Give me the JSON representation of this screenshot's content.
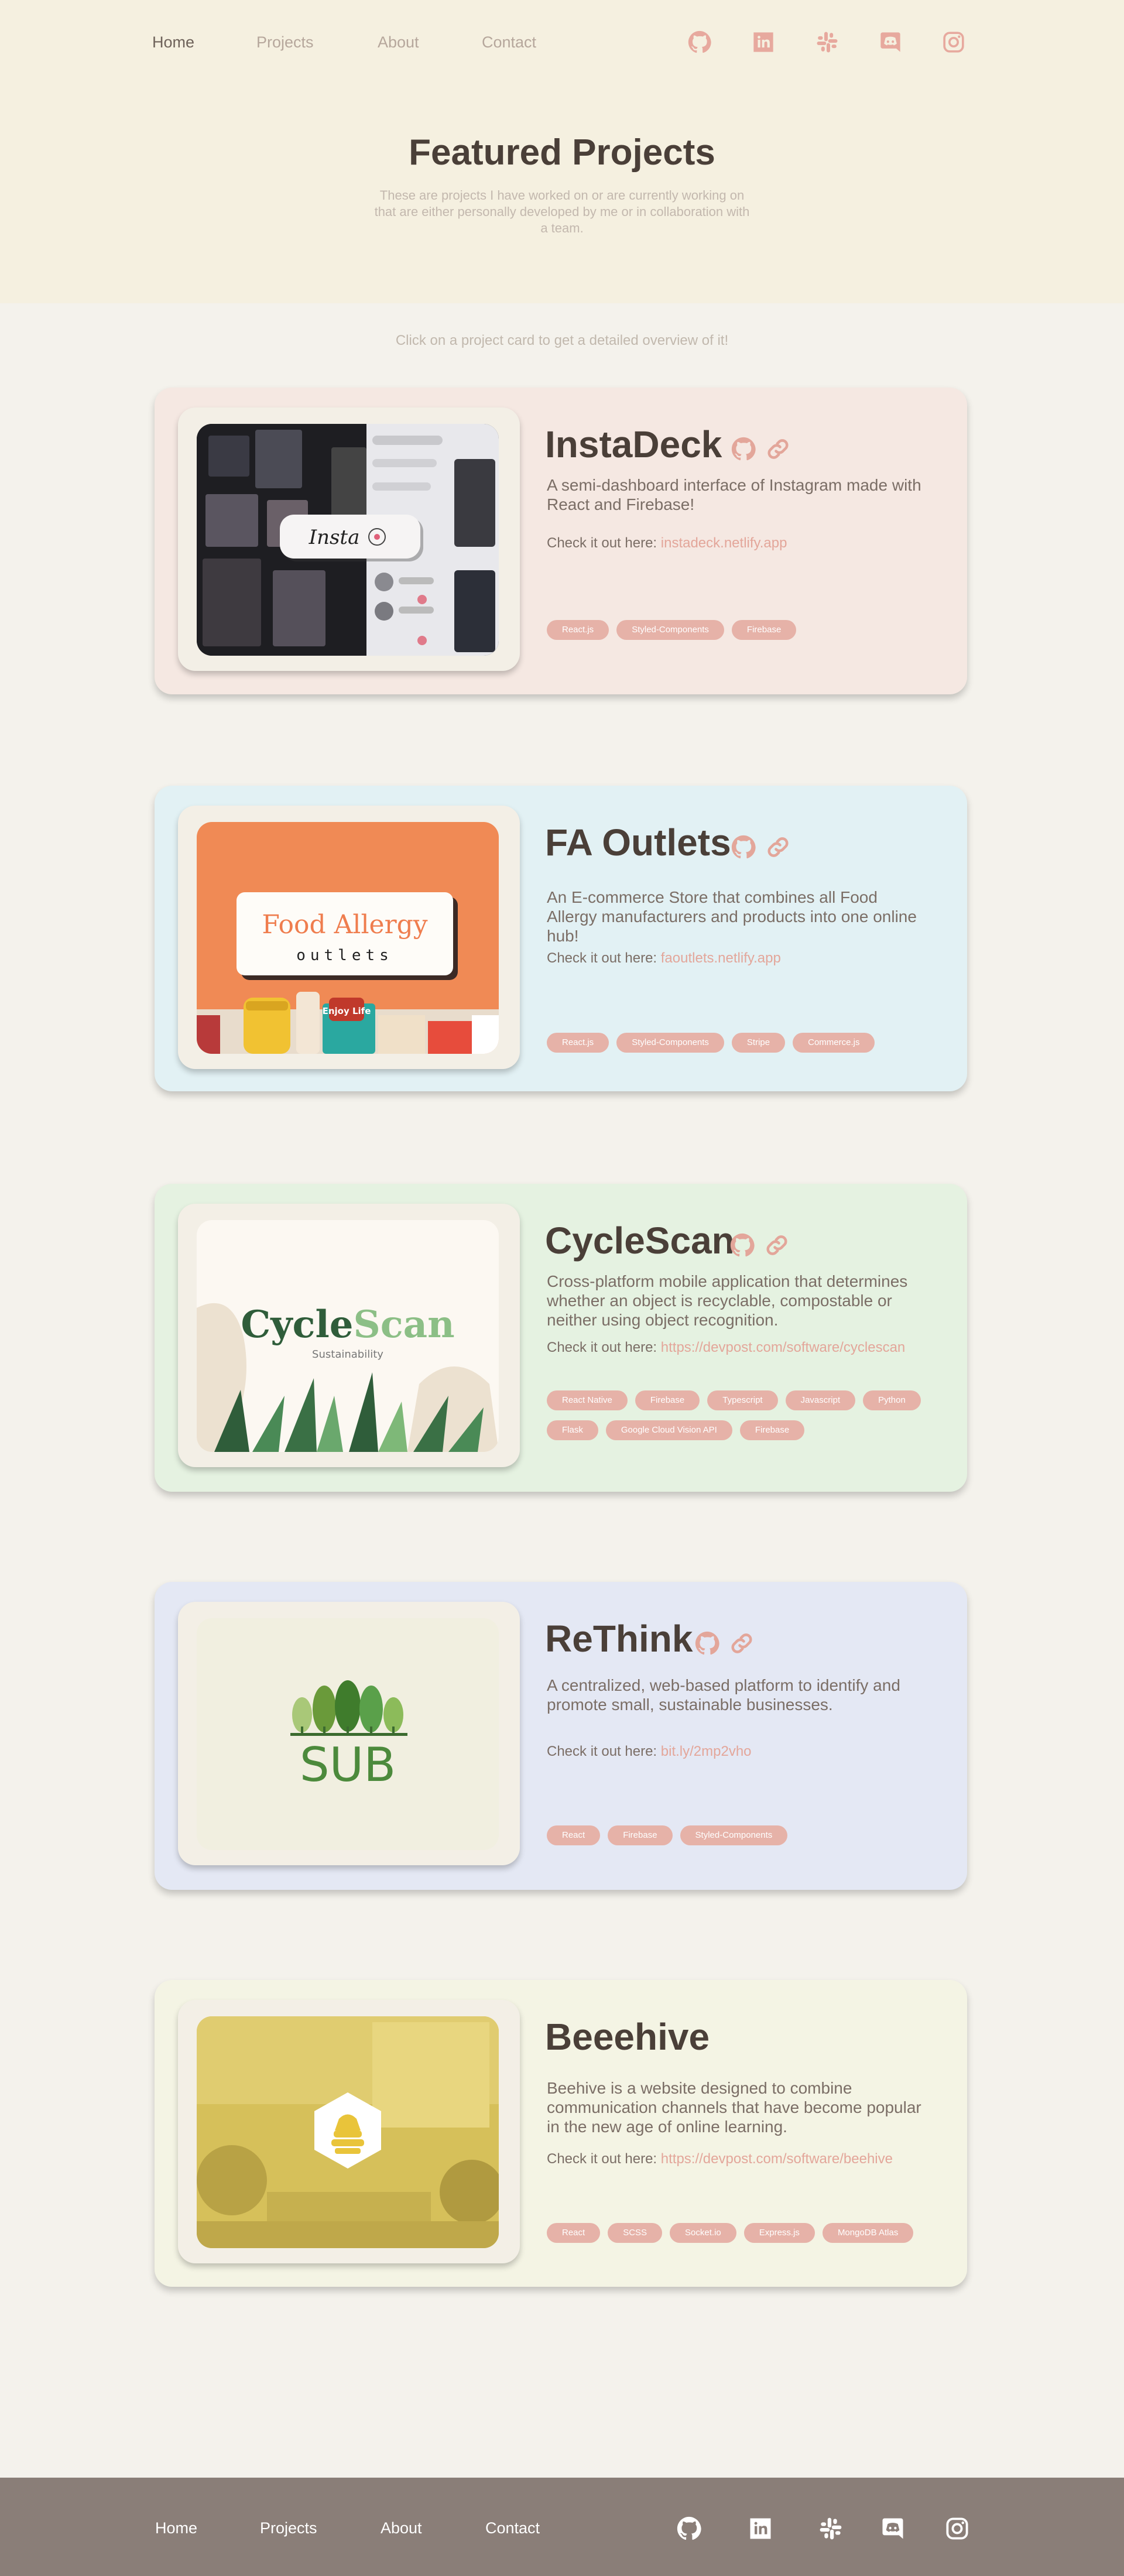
{
  "nav": {
    "home": "Home",
    "projects": "Projects",
    "about": "About",
    "contact": "Contact"
  },
  "social": [
    "github-icon",
    "linkedin-icon",
    "slack-icon",
    "discord-icon",
    "instagram-icon"
  ],
  "header": {
    "title": "Featured Projects",
    "subtitle": "These are projects I have worked on or are currently working on that are either personally developed by me or in collaboration with a team."
  },
  "hint": "Click on a project card to get a detailed overview of it!",
  "colors": {
    "accent": "#e3a69a",
    "tag": "#e6b2a8",
    "text": "#4a3f38",
    "footer": "#8a7e78",
    "hero": "#f5f0e0",
    "page": "#f4f2ec"
  },
  "projects": [
    {
      "title": "InstaDeck",
      "bg": "#f5e8e2",
      "desc": "A semi-dashboard interface of Instagram made with React and Firebase!",
      "check_label": "Check it out here: ",
      "link": "instadeck.netlify.app",
      "tags": [
        "React.js",
        "Styled-Components",
        "Firebase"
      ],
      "icons": [
        "github-icon",
        "link-icon"
      ],
      "logo": "Insta"
    },
    {
      "title": "FA Outlets",
      "bg": "#e2f1f4",
      "desc": "An E-commerce Store that combines all Food Allergy manufacturers and products into one online hub!",
      "check_label": "Check it out here: ",
      "link": "faoutlets.netlify.app",
      "tags": [
        "React.js",
        "Styled-Components",
        "Stripe",
        "Commerce.js"
      ],
      "icons": [
        "github-icon",
        "link-icon"
      ],
      "logo_line1": "Food Allergy",
      "logo_line2": "outlets",
      "product_label": "Enjoy Life"
    },
    {
      "title": "CycleScan",
      "bg": "#e5f2e1",
      "desc": "Cross-platform mobile application that determines whether an object is recyclable, compostable or neither using object recognition.",
      "check_label": "Check it out here: ",
      "link": "https://devpost.com/software/cyclescan",
      "tags": [
        "React Native",
        "Firebase",
        "Typescript",
        "Javascript",
        "Python",
        "Flask",
        "Google Cloud Vision API",
        "Firebase"
      ],
      "icons": [
        "github-icon",
        "link-icon"
      ],
      "logo_a": "Cycle",
      "logo_b": "Scan",
      "logo_sub": "Sustainability"
    },
    {
      "title": "ReThink",
      "bg": "#e4e8f4",
      "desc": "A centralized, web-based platform to identify and promote small, sustainable businesses.",
      "check_label": "Check it out here: ",
      "link": "bit.ly/2mp2vho",
      "tags": [
        "React",
        "Firebase",
        "Styled-Components"
      ],
      "icons": [
        "github-icon",
        "link-icon"
      ],
      "logo": "SUB"
    },
    {
      "title": "Beeehive",
      "bg": "#f4f4e4",
      "desc": "Beehive is a website designed to combine communication channels that have become popular in the new age of online learning.",
      "check_label": "Check it out here: ",
      "link": "https://devpost.com/software/beehive",
      "tags": [
        "React",
        "SCSS",
        "Socket.io",
        "Express.js",
        "MongoDB Atlas"
      ],
      "icons": []
    }
  ],
  "footer": {
    "home": "Home",
    "projects": "Projects",
    "about": "About",
    "contact": "Contact"
  }
}
